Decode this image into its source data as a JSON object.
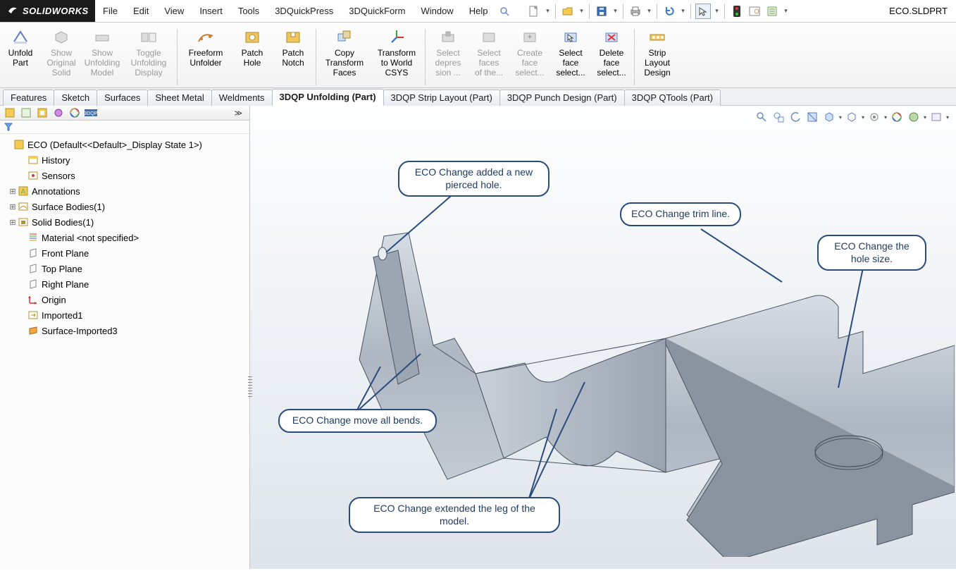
{
  "app": {
    "logo_text": "SOLIDWORKS",
    "doc_name": "ECO.SLDPRT"
  },
  "menu": [
    "File",
    "Edit",
    "View",
    "Insert",
    "Tools",
    "3DQuickPress",
    "3DQuickForm",
    "Window",
    "Help"
  ],
  "qa_icons": [
    "new-doc-icon",
    "open-icon",
    "save-icon",
    "print-icon",
    "undo-icon",
    "select-icon",
    "rebuild-traffic-icon",
    "options-icon",
    "properties-icon"
  ],
  "ribbon": [
    {
      "label": "Unfold\nPart",
      "enabled": true,
      "icon": "unfold-part-icon"
    },
    {
      "label": "Show\nOriginal\nSolid",
      "enabled": false,
      "icon": "show-solid-icon"
    },
    {
      "label": "Show\nUnfolding\nModel",
      "enabled": false,
      "icon": "show-unfold-icon"
    },
    {
      "label": "Toggle\nUnfolding\nDisplay",
      "enabled": false,
      "icon": "toggle-display-icon",
      "wide": true
    },
    {
      "divider": true
    },
    {
      "label": "Freeform\nUnfolder",
      "enabled": true,
      "icon": "freeform-icon",
      "wide": true
    },
    {
      "label": "Patch\nHole",
      "enabled": true,
      "icon": "patch-hole-icon"
    },
    {
      "label": "Patch\nNotch",
      "enabled": true,
      "icon": "patch-notch-icon"
    },
    {
      "divider": true
    },
    {
      "label": "Copy\nTransform\nFaces",
      "enabled": true,
      "icon": "copy-tx-icon",
      "wide": true
    },
    {
      "label": "Transform\nto World\nCSYS",
      "enabled": true,
      "icon": "world-csys-icon",
      "wide": true
    },
    {
      "divider": true
    },
    {
      "label": "Select\ndepres\nsion ...",
      "enabled": false,
      "icon": "sel-depression-icon"
    },
    {
      "label": "Select\nfaces\nof the...",
      "enabled": false,
      "icon": "sel-faces-icon"
    },
    {
      "label": "Create\nface\nselect...",
      "enabled": false,
      "icon": "create-facesel-icon"
    },
    {
      "label": "Select\nface\nselect...",
      "enabled": true,
      "icon": "sel-facesel-icon"
    },
    {
      "label": "Delete\nface\nselect...",
      "enabled": true,
      "icon": "del-facesel-icon"
    },
    {
      "divider": true
    },
    {
      "label": "Strip\nLayout\nDesign",
      "enabled": true,
      "icon": "strip-layout-icon"
    }
  ],
  "tabs": [
    "Features",
    "Sketch",
    "Surfaces",
    "Sheet Metal",
    "Weldments",
    "3DQP Unfolding (Part)",
    "3DQP Strip Layout (Part)",
    "3DQP Punch Design (Part)",
    "3DQP QTools (Part)"
  ],
  "active_tab": 5,
  "tree": {
    "root": "ECO  (Default<<Default>_Display State 1>)",
    "items": [
      {
        "label": "History",
        "icon": "history-icon",
        "indent": 1
      },
      {
        "label": "Sensors",
        "icon": "sensors-icon",
        "indent": 1
      },
      {
        "label": "Annotations",
        "icon": "annotations-icon",
        "indent": 1,
        "expand": "+"
      },
      {
        "label": "Surface Bodies(1)",
        "icon": "surface-bodies-icon",
        "indent": 1,
        "expand": "+"
      },
      {
        "label": "Solid Bodies(1)",
        "icon": "solid-bodies-icon",
        "indent": 1,
        "expand": "+"
      },
      {
        "label": "Material <not specified>",
        "icon": "material-icon",
        "indent": 1
      },
      {
        "label": "Front Plane",
        "icon": "plane-icon",
        "indent": 1
      },
      {
        "label": "Top Plane",
        "icon": "plane-icon",
        "indent": 1
      },
      {
        "label": "Right Plane",
        "icon": "plane-icon",
        "indent": 1
      },
      {
        "label": "Origin",
        "icon": "origin-icon",
        "indent": 1
      },
      {
        "label": "Imported1",
        "icon": "imported-icon",
        "indent": 1
      },
      {
        "label": "Surface-Imported3",
        "icon": "surfimport-icon",
        "indent": 1
      }
    ]
  },
  "callouts": {
    "c1": "ECO Change added a new pierced hole.",
    "c2": "ECO Change trim line.",
    "c3": "ECO Change the hole size.",
    "c4": "ECO Change move all bends.",
    "c5": "ECO Change extended the leg of the model."
  },
  "colors": {
    "callout_border": "#2a4b7c"
  }
}
